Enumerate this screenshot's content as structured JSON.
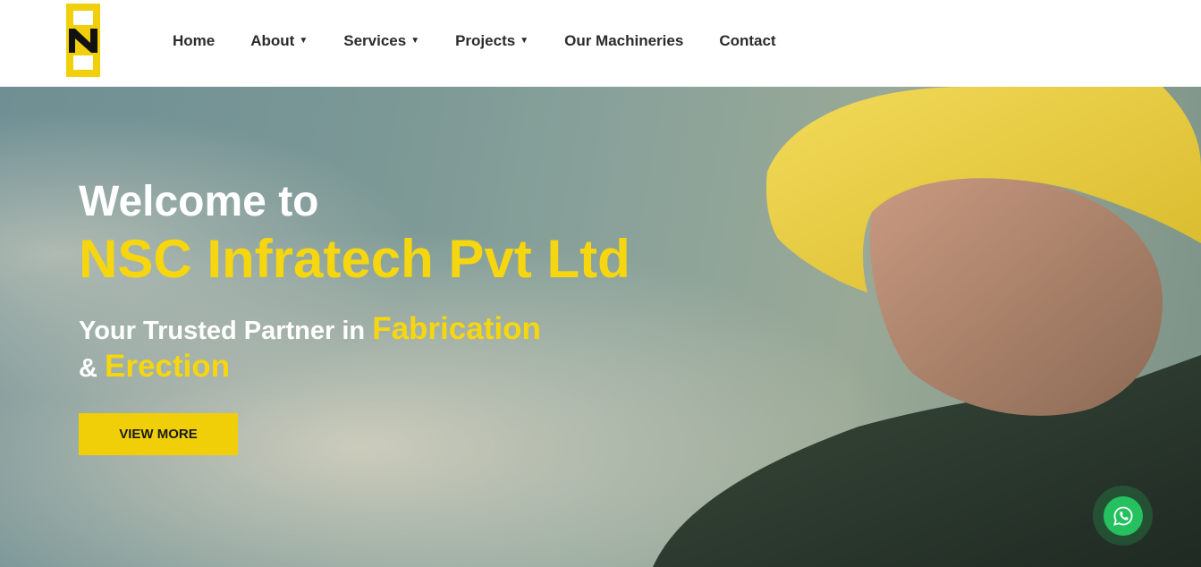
{
  "colors": {
    "accent": "#f6d60f",
    "button": "#f0cf08",
    "whatsapp": "#25c15f"
  },
  "header": {
    "logo_icon": "nsc-logo-icon",
    "nav": [
      {
        "label": "Home",
        "dropdown": false
      },
      {
        "label": "About",
        "dropdown": true
      },
      {
        "label": "Services",
        "dropdown": true
      },
      {
        "label": "Projects",
        "dropdown": true
      },
      {
        "label": "Our Machineries",
        "dropdown": false
      },
      {
        "label": "Contact",
        "dropdown": false
      }
    ]
  },
  "hero": {
    "welcome": "Welcome to",
    "company": "NSC Infratech Pvt Ltd",
    "tagline_part1": "Your Trusted Partner in ",
    "tagline_hl1": "Fabrication",
    "tagline_part2": "& ",
    "tagline_hl2": "Erection",
    "button_label": "VIEW MORE"
  },
  "floating": {
    "whatsapp_icon": "whatsapp-icon"
  }
}
